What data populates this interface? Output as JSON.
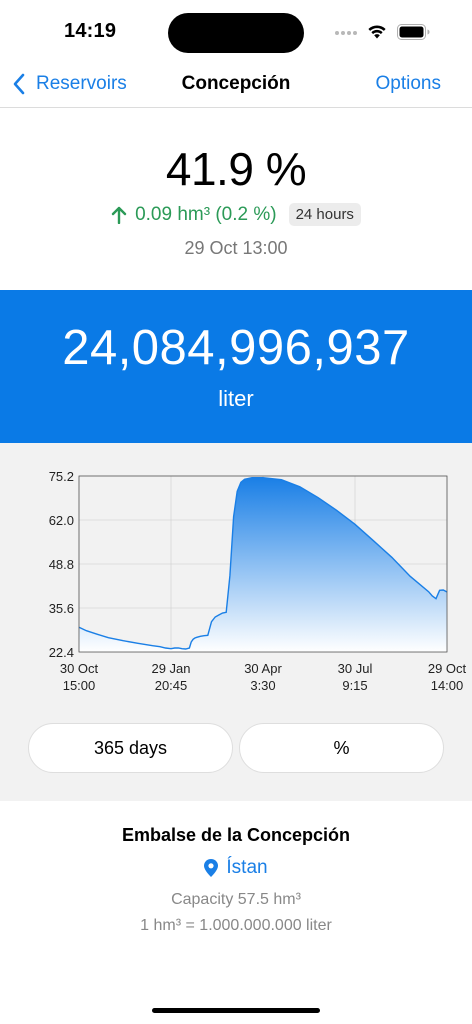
{
  "status_bar": {
    "time": "14:19"
  },
  "nav": {
    "back_label": "Reservoirs",
    "title": "Concepción",
    "options_label": "Options"
  },
  "summary": {
    "percent": "41.9 %",
    "change": "0.09 hm³ (0.2 %)",
    "period": "24 hours",
    "timestamp": "29 Oct 13:00"
  },
  "volume": {
    "value": "24,084,996,937",
    "unit": "liter"
  },
  "chart_data": {
    "type": "area",
    "y_ticks": [
      "75.2",
      "62.0",
      "48.8",
      "35.6",
      "22.4"
    ],
    "ylim": [
      22.4,
      75.2
    ],
    "x_ticks": [
      {
        "date": "30 Oct",
        "time": "15:00"
      },
      {
        "date": "29 Jan",
        "time": "20:45"
      },
      {
        "date": "30 Apr",
        "time": "3:30"
      },
      {
        "date": "30 Jul",
        "time": "9:15"
      },
      {
        "date": "29 Oct",
        "time": "14:00"
      }
    ],
    "grid": true,
    "series": [
      {
        "x": [
          0.0,
          0.02,
          0.05,
          0.08,
          0.12,
          0.16,
          0.2,
          0.22,
          0.235,
          0.25,
          0.26,
          0.27,
          0.28,
          0.29,
          0.3,
          0.305,
          0.31,
          0.315,
          0.32,
          0.33,
          0.34,
          0.35,
          0.36,
          0.37,
          0.38,
          0.39,
          0.4,
          0.41,
          0.42,
          0.43,
          0.44,
          0.45,
          0.47,
          0.5,
          0.55,
          0.6,
          0.65,
          0.7,
          0.75,
          0.8,
          0.85,
          0.9,
          0.95,
          0.96,
          0.97,
          0.98,
          0.99,
          1.0
        ],
        "values": [
          29.8,
          28.8,
          27.7,
          26.7,
          25.8,
          25.0,
          24.3,
          24.0,
          23.6,
          23.4,
          23.6,
          23.6,
          23.4,
          23.3,
          23.6,
          25.4,
          26.2,
          26.6,
          26.8,
          27.1,
          27.3,
          27.4,
          31.5,
          32.9,
          33.5,
          34.1,
          34.3,
          45.3,
          63.0,
          70.6,
          73.3,
          74.2,
          74.7,
          74.7,
          74.1,
          72.0,
          68.7,
          64.9,
          60.7,
          55.8,
          50.8,
          45.1,
          40.5,
          39.2,
          38.4,
          40.9,
          41.0,
          40.4
        ]
      }
    ],
    "line_color": "#1a7fe6",
    "fill_top_color": "#1a7fe6",
    "fill_bottom_color": "#ffffff"
  },
  "controls": {
    "range_label": "365 days",
    "unit_label": "%"
  },
  "info": {
    "name": "Embalse de la Concepción",
    "location": "Ístan",
    "capacity": "Capacity 57.5 hm³",
    "conversion": "1 hm³ = 1.000.000.000 liter"
  }
}
